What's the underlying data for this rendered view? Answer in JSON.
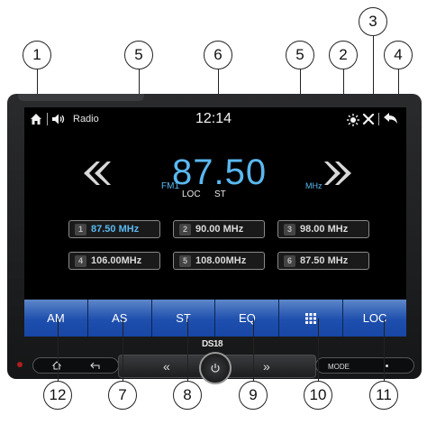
{
  "status_bar": {
    "source": "Radio",
    "time": "12:14",
    "icons": [
      "home-icon",
      "speaker-icon",
      "brightness-icon",
      "settings-icon",
      "back-icon"
    ]
  },
  "tuner": {
    "band": "FM1",
    "frequency": "87.50",
    "unit": "MHz",
    "flags": [
      "LOC",
      "ST"
    ]
  },
  "presets": [
    {
      "num": "1",
      "label": "87.50 MHz"
    },
    {
      "num": "2",
      "label": "90.00 MHz"
    },
    {
      "num": "3",
      "label": "98.00 MHz"
    },
    {
      "num": "4",
      "label": "106.00MHz"
    },
    {
      "num": "5",
      "label": "108.00MHz"
    },
    {
      "num": "6",
      "label": "87.50 MHz"
    }
  ],
  "menu": [
    "AM",
    "AS",
    "ST",
    "EQ",
    "apps-grid-icon",
    "LOC"
  ],
  "hardware": {
    "logo": "DS18",
    "mode_label": "MODE",
    "seek_back": "«",
    "seek_forward": "»"
  },
  "callouts": [
    "1",
    "5",
    "6",
    "5",
    "2",
    "3",
    "4",
    "12",
    "7",
    "8",
    "9",
    "10",
    "11"
  ],
  "colors": {
    "accent": "#5ab8f0",
    "menu_blue": "#1e4fae"
  }
}
